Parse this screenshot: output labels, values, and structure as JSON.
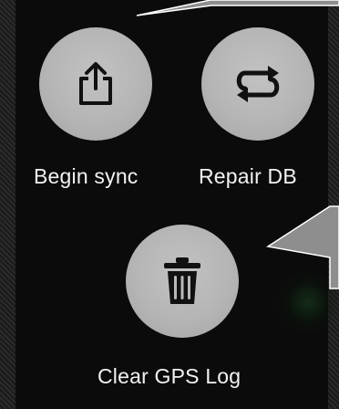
{
  "actions": [
    {
      "id": "begin-sync",
      "label": "Begin sync",
      "icon": "share-icon"
    },
    {
      "id": "repair-db",
      "label": "Repair DB",
      "icon": "repeat-icon"
    },
    {
      "id": "clear-gps-log",
      "label": "Clear GPS Log",
      "icon": "trash-icon"
    }
  ],
  "colors": {
    "button_fill": "#b9b9b9",
    "icon": "#111111",
    "label": "#f2f2f2",
    "callout_fill": "#8e8e8e",
    "background": "#0b0b0b"
  }
}
